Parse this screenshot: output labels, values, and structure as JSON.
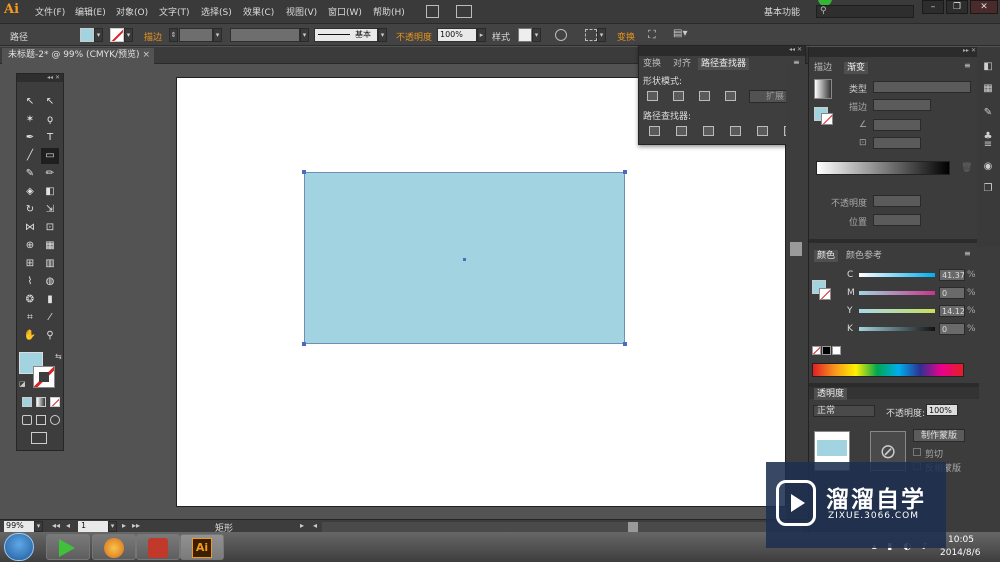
{
  "app": {
    "logo": "Ai",
    "workspace": "基本功能"
  },
  "menu": [
    "文件(F)",
    "编辑(E)",
    "对象(O)",
    "文字(T)",
    "选择(S)",
    "效果(C)",
    "视图(V)",
    "窗口(W)",
    "帮助(H)"
  ],
  "control": {
    "selection_label": "路径",
    "stroke_label": "描边",
    "stroke_style": "基本",
    "opacity_label": "不透明度",
    "opacity_value": "100%",
    "style_label": "样式",
    "transform_label": "变换"
  },
  "document": {
    "tab_title": "未标题-2* @ 99% (CMYK/预览)"
  },
  "colors": {
    "fill": "#a1d4e0",
    "artboard": "#ffffff",
    "accent_orange": "#e8951e"
  },
  "pathfinder": {
    "tabs": [
      "变换",
      "对齐",
      "路径查找器"
    ],
    "shape_modes_label": "形状模式:",
    "expand_button": "扩展",
    "pathfinders_label": "路径查找器:"
  },
  "gradient": {
    "tabs": [
      "描边",
      "渐变"
    ],
    "type_label": "类型",
    "stroke_label": "描边",
    "angle_symbol": "∠",
    "ratio_symbol": "⊡",
    "opacity_label": "不透明度",
    "position_label": "位置"
  },
  "color": {
    "tabs": [
      "颜色",
      "颜色参考"
    ],
    "channels": [
      {
        "name": "C",
        "value": "41.37",
        "unit": "%"
      },
      {
        "name": "M",
        "value": "0",
        "unit": "%"
      },
      {
        "name": "Y",
        "value": "14.12",
        "unit": "%"
      },
      {
        "name": "K",
        "value": "0",
        "unit": "%"
      }
    ]
  },
  "transparency": {
    "title": "透明度",
    "blend_mode": "正常",
    "opacity_label": "不透明度:",
    "opacity_value": "100%",
    "make_mask_button": "制作蒙版",
    "clip_label": "剪切",
    "invert_label": "反相蒙版"
  },
  "status": {
    "zoom": "99%",
    "page": "1",
    "tool_name": "矩形"
  },
  "taskbar": {
    "time": "10:05",
    "date": "2014/8/6",
    "active_app": "Ai"
  },
  "watermark": {
    "title": "溜溜自学",
    "subtitle": "ZIXUE.3066.COM"
  }
}
